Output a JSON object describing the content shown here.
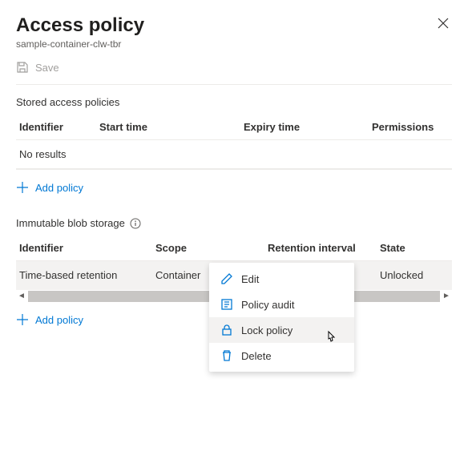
{
  "header": {
    "title": "Access policy",
    "subtitle": "sample-container-clw-tbr"
  },
  "toolbar": {
    "save_label": "Save"
  },
  "stored_access": {
    "section_label": "Stored access policies",
    "columns": {
      "identifier": "Identifier",
      "start": "Start time",
      "expiry": "Expiry time",
      "permissions": "Permissions"
    },
    "no_results": "No results",
    "add_label": "Add policy"
  },
  "immutable": {
    "section_label": "Immutable blob storage",
    "columns": {
      "identifier": "Identifier",
      "scope": "Scope",
      "retention": "Retention interval",
      "state": "State"
    },
    "row": {
      "identifier": "Time-based retention",
      "scope": "Container",
      "retention": "",
      "state": "Unlocked"
    },
    "add_label": "Add policy"
  },
  "context_menu": {
    "edit": "Edit",
    "audit": "Policy audit",
    "lock": "Lock policy",
    "delete": "Delete"
  }
}
